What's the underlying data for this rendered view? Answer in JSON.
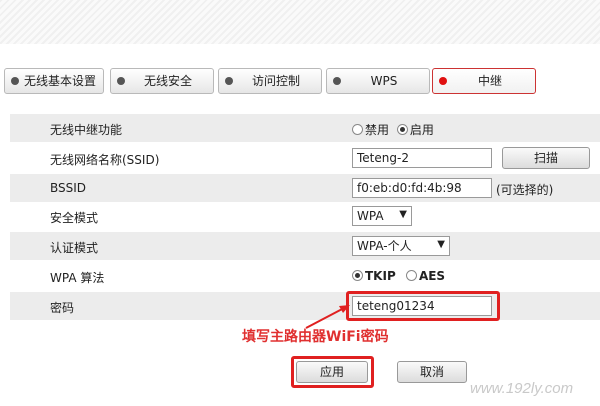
{
  "tabs": [
    {
      "label": "无线基本设置"
    },
    {
      "label": "无线安全"
    },
    {
      "label": "访问控制"
    },
    {
      "label": "WPS"
    },
    {
      "label": "中继"
    }
  ],
  "form": {
    "repeater": {
      "label": "无线中继功能",
      "options": [
        "禁用",
        "启用"
      ],
      "selected": "启用"
    },
    "ssid": {
      "label": "无线网络名称(SSID)",
      "value": "Teteng-2",
      "scan_button": "扫描"
    },
    "bssid": {
      "label": "BSSID",
      "value": "f0:eb:d0:fd:4b:98",
      "hint": "(可选择的)"
    },
    "security_mode": {
      "label": "安全模式",
      "value": "WPA"
    },
    "auth_mode": {
      "label": "认证模式",
      "value": "WPA-个人"
    },
    "wpa_algo": {
      "label": "WPA 算法",
      "options": [
        "TKIP",
        "AES"
      ],
      "selected": "TKIP"
    },
    "password": {
      "label": "密码",
      "value": "teteng01234"
    }
  },
  "annotation": "填写主路由器WiFi密码",
  "buttons": {
    "apply": "应用",
    "cancel": "取消"
  },
  "watermark": "www.192ly.com",
  "colors": {
    "accent_red": "#e02020",
    "row_shade": "#ececec"
  }
}
